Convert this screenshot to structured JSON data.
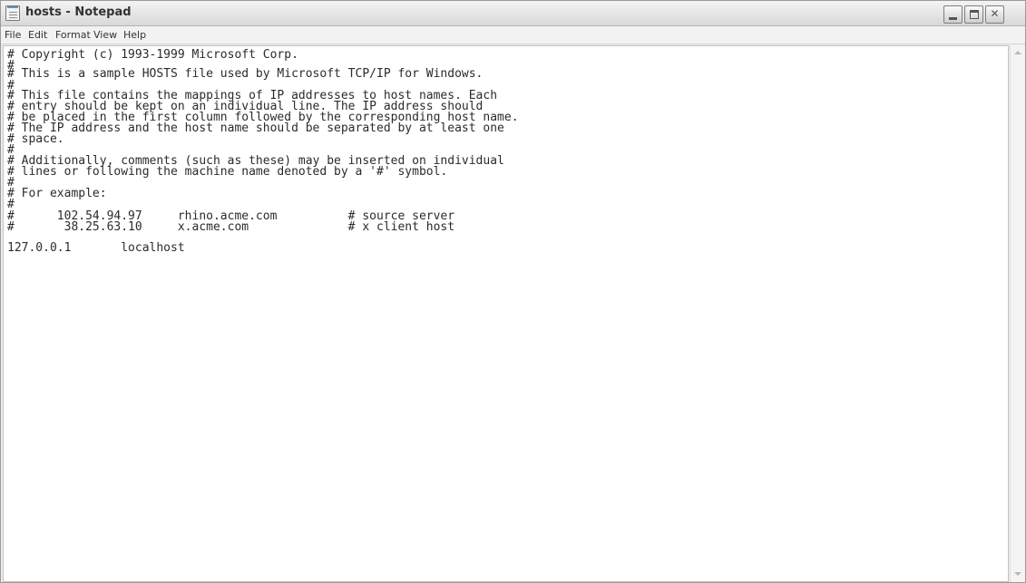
{
  "window": {
    "title": "hosts - Notepad",
    "controls": {
      "minimize": "minimize-icon",
      "maximize": "maximize-icon",
      "close": "close-icon",
      "close_glyph": "✕"
    }
  },
  "menubar": {
    "items": [
      {
        "label": "File"
      },
      {
        "label": "Edit"
      },
      {
        "label": "Format"
      },
      {
        "label": "View"
      },
      {
        "label": "Help"
      }
    ]
  },
  "editor": {
    "lines": [
      "# Copyright (c) 1993-1999 Microsoft Corp.",
      "#",
      "# This is a sample HOSTS file used by Microsoft TCP/IP for Windows.",
      "#",
      "# This file contains the mappings of IP addresses to host names. Each",
      "# entry should be kept on an individual line. The IP address should",
      "# be placed in the first column followed by the corresponding host name.",
      "# The IP address and the host name should be separated by at least one",
      "# space.",
      "#",
      "# Additionally, comments (such as these) may be inserted on individual",
      "# lines or following the machine name denoted by a '#' symbol.",
      "#",
      "# For example:",
      "#",
      "#      102.54.94.97     rhino.acme.com          # source server",
      "#       38.25.63.10     x.acme.com              # x client host",
      "",
      "127.0.0.1       localhost"
    ]
  }
}
